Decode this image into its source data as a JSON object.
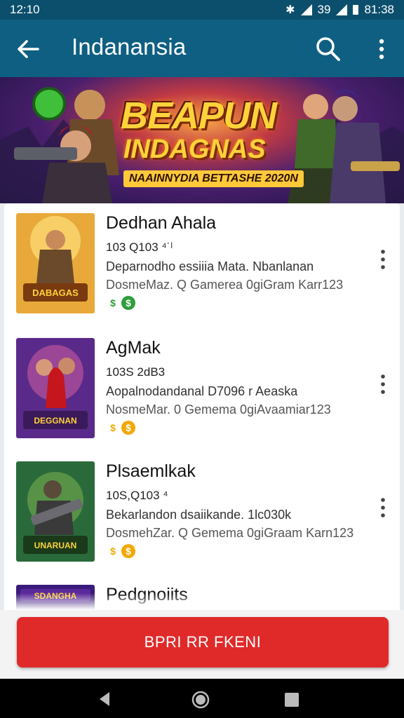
{
  "status": {
    "time": "12:10",
    "signal": "39",
    "clock": "81:38"
  },
  "appbar": {
    "title": "Indanansia"
  },
  "banner": {
    "title": "BEAPUN",
    "subtitle": "INDAGNAS",
    "tagline": "NAAINNYDIA BETTASHE 2020N"
  },
  "items": [
    {
      "title": "Dedhan Ahala",
      "meta1": "103 Q103 ⁴˙ˡ",
      "meta2": "Deparnodho essiiia Mata. Nbanlanan",
      "meta3": "DosmeMaz. Q Gamerea 0giGram Karr123",
      "badges": [
        "$",
        "$"
      ]
    },
    {
      "title": "AgMak",
      "meta1": "103S 2dB3",
      "meta2": "Aopalnodandanal D7096 r Aeaska",
      "meta3": "NosmeMar. 0 Gemema 0giAvaamiar123",
      "badges": [
        "$",
        "$"
      ]
    },
    {
      "title": "Plsaemlkak",
      "meta1": "10S,Q103 ⁴",
      "meta2": "Bekarlandon dsaiikande. 1lc030k",
      "meta3": "DosmehZar. Q Gemema 0giGraam Karn123",
      "badges": [
        "$",
        "$"
      ]
    },
    {
      "title": "Pedgnoiits",
      "meta1": "",
      "meta2": "",
      "meta3": "",
      "badges": []
    }
  ],
  "cta": {
    "label": "BPRI RR FKENI"
  },
  "colors": {
    "primary": "#0e5f82",
    "accent": "#e02a2a",
    "badge_green": "#2e9e3a",
    "badge_gold": "#f2a800"
  }
}
